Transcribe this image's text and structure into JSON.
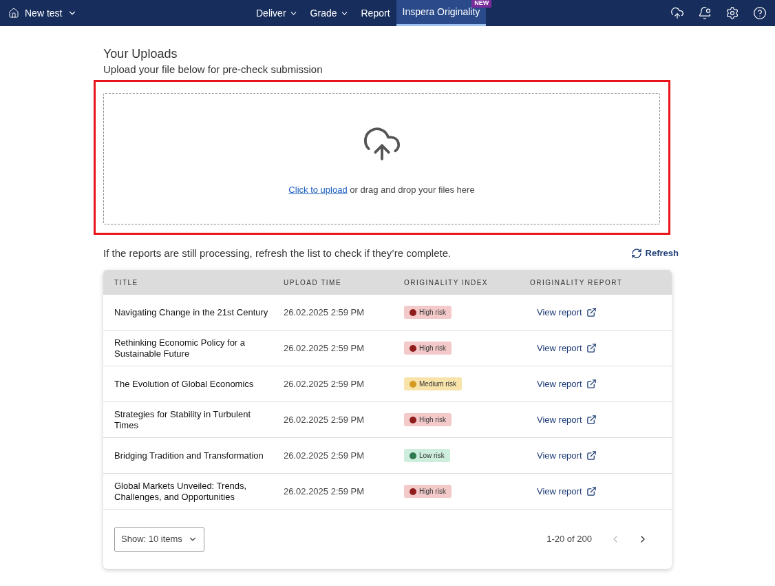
{
  "topbar": {
    "test_name": "New test",
    "nav": [
      {
        "label": "Deliver",
        "dropdown": true,
        "selected": false
      },
      {
        "label": "Grade",
        "dropdown": true,
        "selected": false
      },
      {
        "label": "Report",
        "dropdown": false,
        "selected": false
      },
      {
        "label": "Inspera Originality",
        "dropdown": false,
        "selected": true,
        "badge": "NEW"
      }
    ]
  },
  "heading": "Your Uploads",
  "subheading": "Upload your file below for pre-check submission",
  "upload": {
    "link": "Click to upload",
    "text": " or drag and drop your files here"
  },
  "info": "If the reports are still processing, refresh the list to check if they’re complete.",
  "refresh": "Refresh",
  "table": {
    "columns": [
      "TITLE",
      "UPLOAD TIME",
      "ORIGINALITY INDEX",
      "ORIGINALITY REPORT"
    ],
    "rows": [
      {
        "title": "Navigating Change in the 21st Century",
        "time": "26.02.2025 2:59 PM",
        "risk": "High risk",
        "kind": "high",
        "report": "View report"
      },
      {
        "title": "Rethinking Economic Policy for a Sustainable Future",
        "time": "26.02.2025 2:59 PM",
        "risk": "High risk",
        "kind": "high",
        "report": "View report"
      },
      {
        "title": "The Evolution of Global Economics",
        "time": "26.02.2025 2:59 PM",
        "risk": "Medium risk",
        "kind": "medium",
        "report": "View report"
      },
      {
        "title": "Strategies for Stability in Turbulent Times",
        "time": "26.02.2025 2:59 PM",
        "risk": "High risk",
        "kind": "high",
        "report": "View report"
      },
      {
        "title": "Bridging Tradition and Transformation",
        "time": "26.02.2025 2:59 PM",
        "risk": "Low risk",
        "kind": "low",
        "report": "View report"
      },
      {
        "title": "Global Markets Unveiled: Trends, Challenges, and Opportunities",
        "time": "26.02.2025 2:59 PM",
        "risk": "High risk",
        "kind": "high",
        "report": "View report"
      }
    ]
  },
  "pagination": {
    "show": "Show: 10 items",
    "range": "1-20 of 200",
    "prev_disabled": true,
    "next_disabled": false
  }
}
